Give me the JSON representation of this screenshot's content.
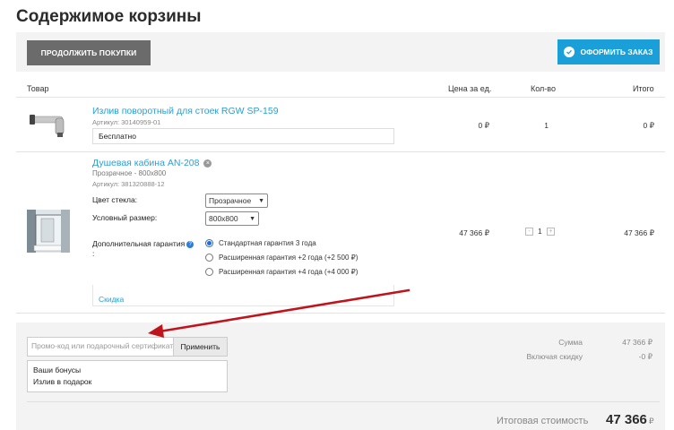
{
  "page": {
    "title": "Содержимое корзины"
  },
  "toolbar": {
    "continue_label": "ПРОДОЛЖИТЬ ПОКУПКИ",
    "checkout_label": "ОФОРМИТЬ ЗАКАЗ"
  },
  "table": {
    "headers": {
      "product": "Товар",
      "price": "Цена за ед.",
      "qty": "Кол-во",
      "total": "Итого"
    }
  },
  "items": [
    {
      "name": "Излив поворотный для стоек RGW SP-159",
      "article": "Артикул: 30140959-01",
      "note": "Бесплатно",
      "price": "0 ₽",
      "qty": "1",
      "total": "0 ₽"
    },
    {
      "name": "Душевая кабина AN-208",
      "variant": "Прозрачное - 800x800",
      "article": "Артикул: 381320888-12",
      "options": {
        "glass_label": "Цвет стекла:",
        "glass_value": "Прозрачное",
        "size_label": "Условный размер:",
        "size_value": "800x800",
        "warranty_label": "Дополнительная гарантия",
        "warranty_colon": ":",
        "warranty_options": [
          "Стандартная гарантия 3 года",
          "Расширенная гарантия +2 года (+2 500 ₽)",
          "Расширенная гарантия +4 года (+4 000 ₽)"
        ]
      },
      "discount_link": "Скидка",
      "price": "47 366 ₽",
      "qty": "1",
      "qty_minus": "-",
      "qty_plus": "+",
      "total": "47 366 ₽"
    }
  ],
  "promo": {
    "placeholder": "Промо-код или подарочный сертификат",
    "apply_label": "Применить"
  },
  "bonus": {
    "title": "Ваши бонусы",
    "gift": "Излив в подарок"
  },
  "summary": {
    "sum_label": "Сумма",
    "sum_value": "47 366 ₽",
    "discount_label": "Включая скидку",
    "discount_value": "-0 ₽",
    "total_label": "Итоговая стоимость",
    "total_value": "47 366",
    "total_currency": "₽"
  },
  "colors": {
    "accent": "#1a9fd9",
    "link": "#2a9fd6",
    "arrow": "#c0141c",
    "dark_button": "#6b6b6b"
  }
}
